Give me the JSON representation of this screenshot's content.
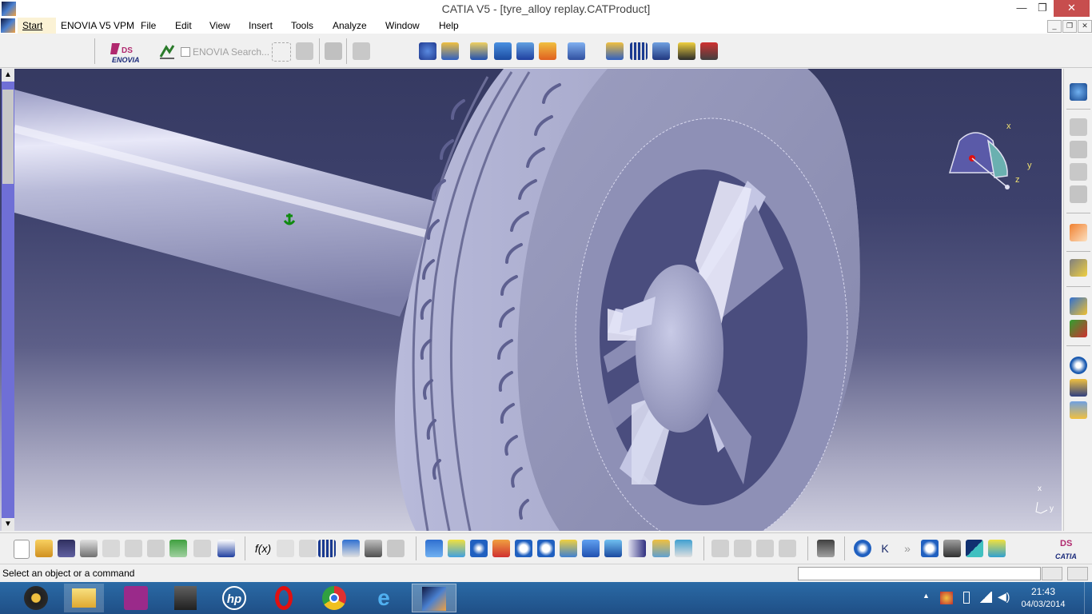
{
  "window": {
    "title": "CATIA V5 - [tyre_alloy replay.CATProduct]"
  },
  "menu": [
    "Start",
    "ENOVIA V5 VPM",
    "File",
    "Edit",
    "View",
    "Insert",
    "Tools",
    "Analyze",
    "Window",
    "Help"
  ],
  "toolbar": {
    "enovia_search_placeholder": "ENOVIA Search..."
  },
  "compass": {
    "x_label": "x",
    "y_label": "y",
    "z_label": "z"
  },
  "axis_triad": {
    "x_label": "x",
    "y_label": "y"
  },
  "status": {
    "message": "Select an object or a command",
    "command_value": ""
  },
  "taskbar": {
    "apps": [
      "media-player-icon",
      "file-explorer-icon",
      "presentation-app-icon",
      "task-manager-icon",
      "hp-icon",
      "opera-icon",
      "chrome-icon",
      "internet-explorer-icon",
      "catia-icon"
    ],
    "time": "21:43",
    "date": "04/03/2014"
  },
  "colors": {
    "viewport_top": "#363a62",
    "viewport_bottom": "#cfcfdf",
    "model": "#a8aacc",
    "taskbar": "#2a6aa6",
    "close_button": "#c74e4e"
  }
}
